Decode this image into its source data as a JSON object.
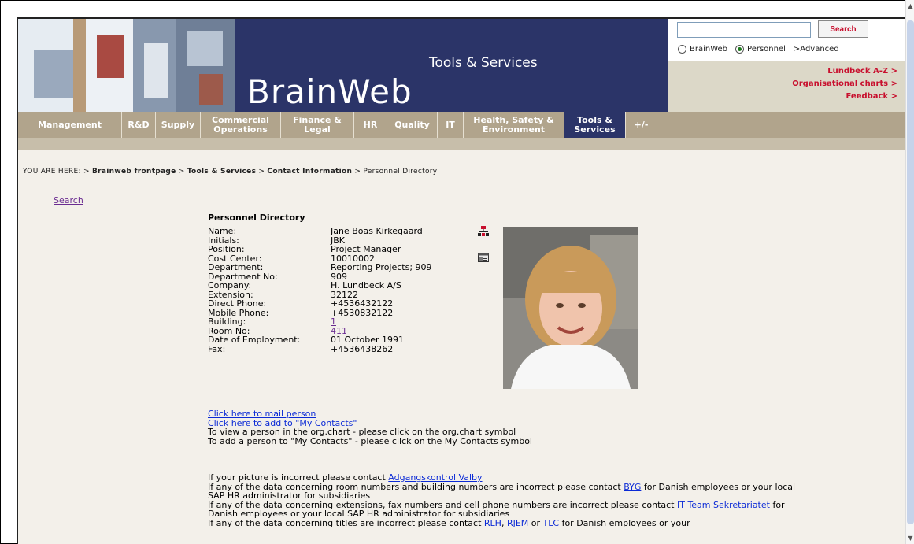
{
  "header": {
    "brand_name": "BrainWeb",
    "section_title": "Tools & Services",
    "search": {
      "input_value": "",
      "button_label": "Search",
      "scope_options": [
        "BrainWeb",
        "Personnel"
      ],
      "selected_scope": "Personnel",
      "advanced_label": ">Advanced"
    },
    "quicklinks": [
      "Lundbeck A-Z >",
      "Organisational charts >",
      "Feedback >"
    ]
  },
  "nav": {
    "items": [
      {
        "label": "Management"
      },
      {
        "label": "R&D"
      },
      {
        "label": "Supply"
      },
      {
        "label": "Commercial Operations"
      },
      {
        "label": "Finance & Legal"
      },
      {
        "label": "HR"
      },
      {
        "label": "Quality"
      },
      {
        "label": "IT"
      },
      {
        "label": "Health, Safety & Environment"
      },
      {
        "label": "Tools & Services"
      },
      {
        "label": "+/-"
      }
    ],
    "active": "Tools & Services"
  },
  "breadcrumb": {
    "prefix": "YOU ARE HERE:",
    "items": [
      "Brainweb frontpage",
      "Tools & Services",
      "Contact Information",
      "Personnel Directory"
    ]
  },
  "search_link": "Search",
  "directory": {
    "title": "Personnel Directory",
    "fields": [
      {
        "label": "Name:",
        "value": "Jane Boas Kirkegaard"
      },
      {
        "label": "Initials:",
        "value": "JBK"
      },
      {
        "label": "Position:",
        "value": "Project Manager"
      },
      {
        "label": "Cost Center:",
        "value": "10010002"
      },
      {
        "label": "Department:",
        "value": "Reporting Projects; 909"
      },
      {
        "label": "Department No:",
        "value": "909"
      },
      {
        "label": "Company:",
        "value": "H. Lundbeck A/S"
      },
      {
        "label": "Extension:",
        "value": "32122"
      },
      {
        "label": "Direct Phone:",
        "value": "+4536432122"
      },
      {
        "label": "Mobile Phone:",
        "value": "+4530832122"
      },
      {
        "label": "Building:",
        "value": "1"
      },
      {
        "label": "Room No:",
        "value": "411"
      },
      {
        "label": "Date of Employment:",
        "value": "01 October 1991"
      },
      {
        "label": "Fax:",
        "value": "+4536438262"
      }
    ],
    "icons": [
      "org-chart-icon",
      "my-contacts-icon"
    ]
  },
  "actions": {
    "mail_link": "Click here to mail person",
    "contacts_link": "Click here to add to \"My Contacts\"",
    "hint_org": "To view a person in the org.chart - please click on the org.chart symbol",
    "hint_contacts": "To add a person to \"My Contacts\" - please click on the My Contacts symbol"
  },
  "help": {
    "picture_text": "If your picture is incorrect please contact",
    "picture_link": "Adgangskontrol Valby",
    "room_text": "If any of the data concerning room numbers and building numbers are incorrect please contact",
    "room_link": "BYG",
    "room_tail": "for Danish employees or your local SAP HR administrator for subsidiaries",
    "ext_text": "If any of the data concerning extensions, fax numbers and cell phone numbers are incorrect please contact",
    "ext_link": "IT Team Sekretariatet",
    "ext_tail": "for Danish employees or your local SAP HR administrator for subsidiaries",
    "titles_text": "If any of the data concerning titles are incorrect please contact",
    "titles_link_1": "RLH",
    "titles_sep_1": ",",
    "titles_link_2": "RJEM",
    "titles_sep_2": "or",
    "titles_link_3": "TLC",
    "titles_tail": "for Danish employees or your"
  },
  "colors": {
    "brand_navy": "#2b3468",
    "nav_tan": "#b1a48c",
    "accent_red": "#c8102e",
    "link_blue": "#0b2ad6",
    "visited_purple": "#6a2c91"
  }
}
